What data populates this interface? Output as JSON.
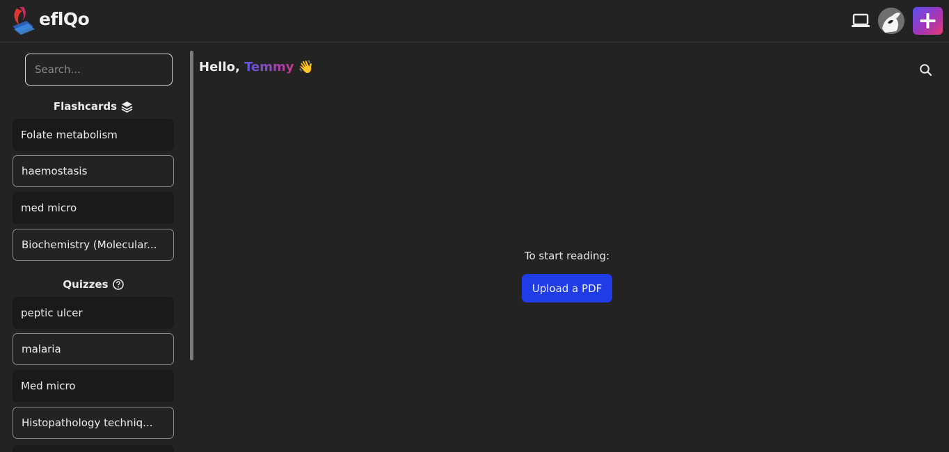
{
  "header": {
    "brand": "eflQo",
    "icons": {
      "logo": "eflqo-logo",
      "device": "laptop-icon",
      "avatar": "avatar",
      "create": "plus-icon"
    },
    "accent_gradient": [
      "#5a4ff0",
      "#e63c74"
    ]
  },
  "sidebar": {
    "search_placeholder": "Search...",
    "flashcards": {
      "title": "Flashcards",
      "icon": "layers-icon",
      "items": [
        {
          "label": "Folate metabolism",
          "style": "filled"
        },
        {
          "label": "haemostasis",
          "style": "outlined"
        },
        {
          "label": "med micro",
          "style": "filled"
        },
        {
          "label": "Biochemistry (Molecular...",
          "style": "outlined"
        }
      ]
    },
    "quizzes": {
      "title": "Quizzes",
      "icon": "question-circle-icon",
      "items": [
        {
          "label": "peptic ulcer",
          "style": "filled"
        },
        {
          "label": "malaria",
          "style": "outlined"
        },
        {
          "label": "Med micro",
          "style": "filled"
        },
        {
          "label": "Histopathology techniq...",
          "style": "outlined"
        }
      ]
    }
  },
  "main": {
    "greeting_prefix": "Hello, ",
    "user_name": "Temmy",
    "wave_emoji": "👋",
    "search_icon": "search-icon",
    "start_text": "To start reading:",
    "upload_label": "Upload a PDF",
    "upload_color": "#1f3ce6"
  }
}
